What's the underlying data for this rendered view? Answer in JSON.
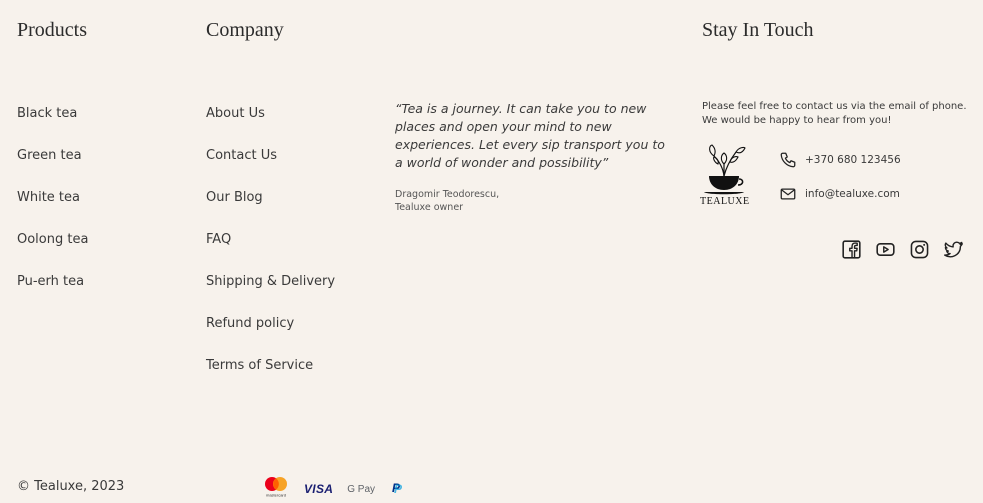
{
  "products": {
    "title": "Products",
    "items": [
      "Black tea",
      "Green tea",
      "White tea",
      "Oolong tea",
      "Pu-erh tea"
    ]
  },
  "company": {
    "title": "Company",
    "items": [
      "About Us",
      "Contact Us",
      "Our Blog",
      "FAQ",
      "Shipping & Delivery",
      "Refund policy",
      "Terms of Service"
    ]
  },
  "quote": {
    "text": "“Tea is a journey. It can take you to new places and open your mind to new experiences. Let every sip transport you to a world of wonder and possibility”",
    "author_name": "Dragomir Teodorescu,",
    "author_role": "Tealuxe owner"
  },
  "touch": {
    "title": "Stay In Touch",
    "intro": "Please feel free to contact us via the email of phone. We would be happy to hear from you!",
    "logo_text": "TEALUXE",
    "phone": "+370 680 123456",
    "email": "info@tealuxe.com",
    "socials": [
      "facebook-icon",
      "youtube-icon",
      "instagram-icon",
      "twitter-icon"
    ]
  },
  "footer": {
    "copyright": "© Tealuxe, 2023",
    "payments": {
      "mastercard_label": "mastercard",
      "visa_label": "VISA",
      "gpay_label": "G Pay",
      "paypal_label": "P"
    }
  },
  "colors": {
    "background": "#f7f2ec",
    "text": "#2b2b2b"
  }
}
